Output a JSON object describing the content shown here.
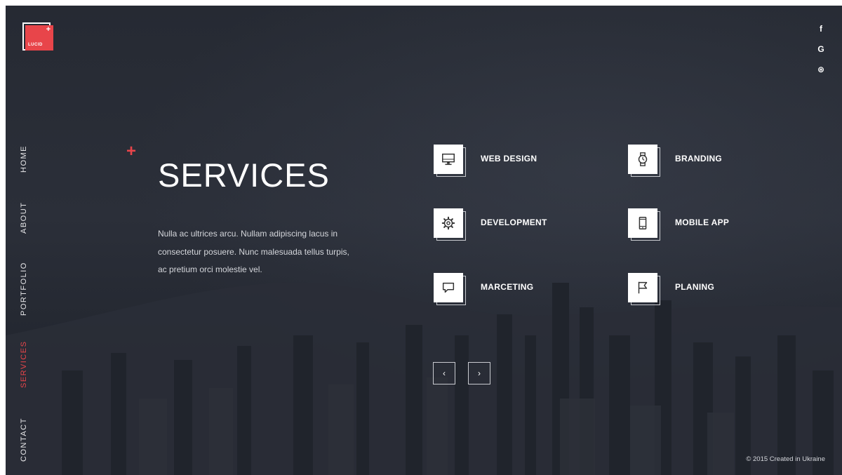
{
  "logo": {
    "text": "LUCID"
  },
  "social": [
    {
      "name": "facebook-icon",
      "glyph": "f"
    },
    {
      "name": "google-icon",
      "glyph": "G"
    },
    {
      "name": "dribbble-icon",
      "glyph": "⊛"
    }
  ],
  "nav": {
    "items": [
      {
        "label": "HOME",
        "active": false
      },
      {
        "label": "ABOUT",
        "active": false
      },
      {
        "label": "PORTFOLIO",
        "active": false
      },
      {
        "label": "SERVICES",
        "active": true
      },
      {
        "label": "CONTACT",
        "active": false
      }
    ]
  },
  "hero": {
    "accent": "+",
    "title": "SERVICES",
    "description": "Nulla ac ultrices arcu. Nullam adipiscing lacus in consectetur posuere. Nunc malesuada tellus turpis, ac pretium orci molestie vel."
  },
  "services": [
    {
      "label": "WEB DESIGN",
      "icon": "monitor-icon"
    },
    {
      "label": "BRANDING",
      "icon": "watch-icon"
    },
    {
      "label": "DEVELOPMENT",
      "icon": "gear-icon"
    },
    {
      "label": "MOBILE APP",
      "icon": "mobile-icon"
    },
    {
      "label": "MARCETING",
      "icon": "chat-icon"
    },
    {
      "label": "PLANING",
      "icon": "flag-icon"
    }
  ],
  "pager": {
    "prev": "‹",
    "next": "›"
  },
  "footer": {
    "text": "© 2015 Created in Ukraine"
  },
  "colors": {
    "accent": "#e8454a",
    "background": "#262a33",
    "text": "#ffffff"
  }
}
